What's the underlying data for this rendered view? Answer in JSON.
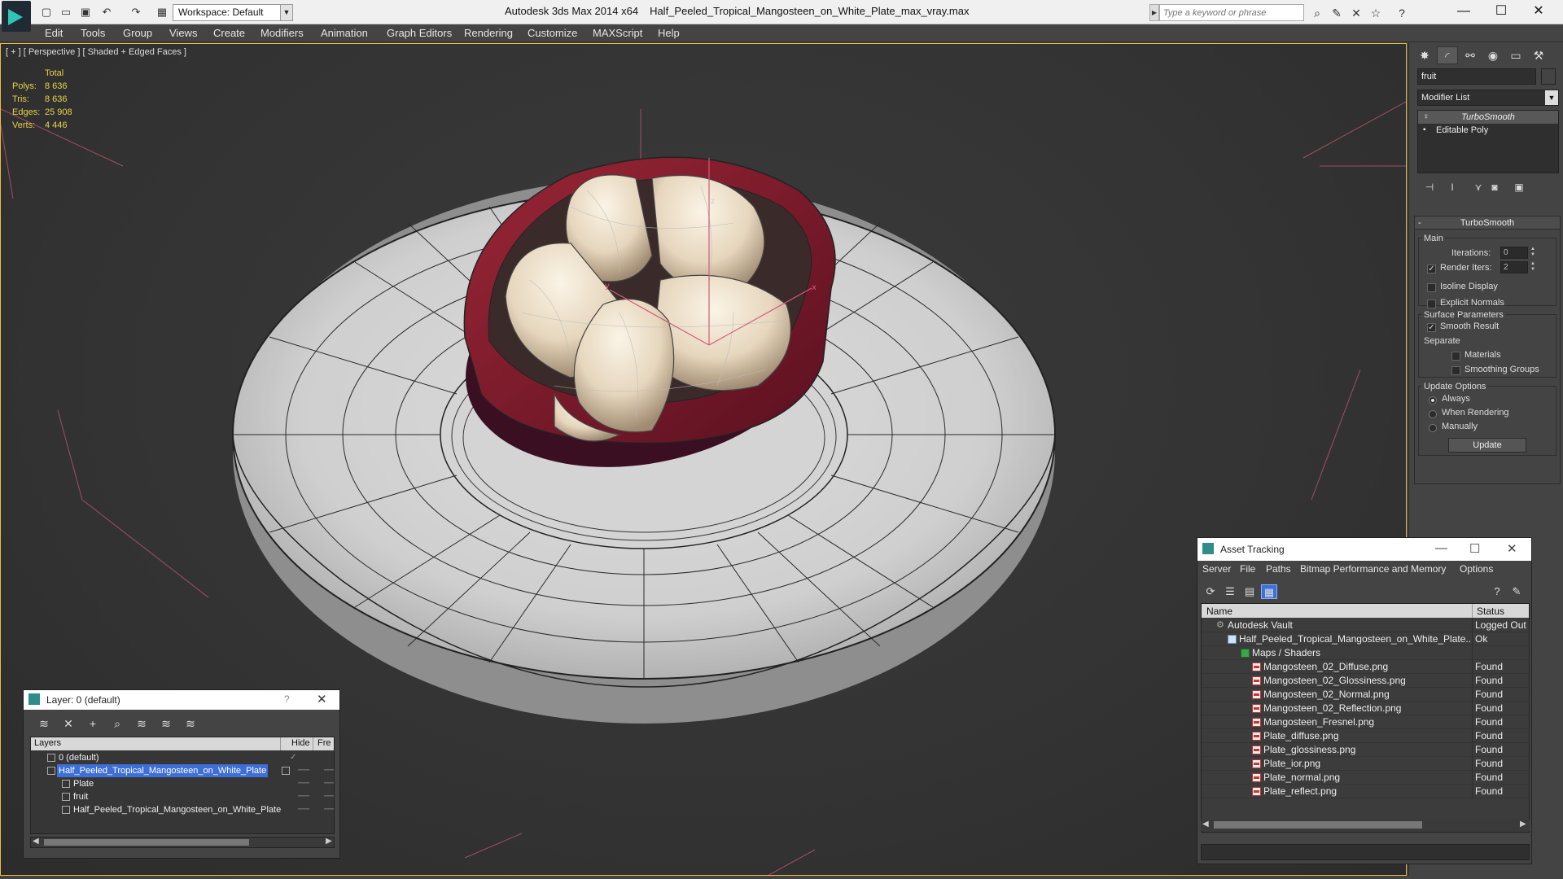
{
  "app": {
    "title": "Autodesk 3ds Max  2014 x64",
    "file": "Half_Peeled_Tropical_Mangosteen_on_White_Plate_max_vray.max",
    "workspace": "Workspace: Default",
    "search_placeholder": "Type a keyword or phrase"
  },
  "menu": [
    "Edit",
    "Tools",
    "Group",
    "Views",
    "Create",
    "Modifiers",
    "Animation",
    "Graph Editors",
    "Rendering",
    "Customize",
    "MAXScript",
    "Help"
  ],
  "viewport": {
    "label": "[ + ] [ Perspective ] [ Shaded + Edged Faces ]",
    "stats": {
      "total_label": "Total",
      "rows": [
        {
          "label": "Polys:",
          "value": "8 636"
        },
        {
          "label": "Tris:",
          "value": "8 636"
        },
        {
          "label": "Edges:",
          "value": "25 908"
        },
        {
          "label": "Verts:",
          "value": "4 446"
        }
      ]
    }
  },
  "command_panel": {
    "object_name": "fruit",
    "modifier_list": "Modifier List",
    "stack": [
      "TurboSmooth",
      "Editable Poly"
    ],
    "rollout_title": "TurboSmooth",
    "main_group": "Main",
    "iterations_label": "Iterations:",
    "iterations_value": "0",
    "render_iters_label": "Render Iters:",
    "render_iters_value": "2",
    "isoline_label": "Isoline Display",
    "explicit_normals_label": "Explicit Normals",
    "surface_group": "Surface Parameters",
    "smooth_result_label": "Smooth Result",
    "separate_label": "Separate",
    "materials_label": "Materials",
    "smoothing_groups_label": "Smoothing Groups",
    "update_group": "Update Options",
    "always_label": "Always",
    "when_rendering_label": "When Rendering",
    "manually_label": "Manually",
    "update_button": "Update"
  },
  "layer_dialog": {
    "title": "Layer: 0 (default)",
    "help": "?",
    "columns": {
      "layers": "Layers",
      "hide": "Hide",
      "freeze": "Fre"
    },
    "rows": [
      {
        "name": "0 (default)"
      },
      {
        "name": "Half_Peeled_Tropical_Mangosteen_on_White_Plate"
      },
      {
        "name": "Plate"
      },
      {
        "name": "fruit"
      },
      {
        "name": "Half_Peeled_Tropical_Mangosteen_on_White_Plate"
      }
    ]
  },
  "asset_tracking": {
    "title": "Asset Tracking",
    "menu": [
      "Server",
      "File",
      "Paths",
      "Bitmap Performance and Memory",
      "Options"
    ],
    "columns": {
      "name": "Name",
      "status": "Status"
    },
    "rows": [
      {
        "name": "Autodesk Vault",
        "status": "Logged Out"
      },
      {
        "name": "Half_Peeled_Tropical_Mangosteen_on_White_Plate...",
        "status": "Ok"
      },
      {
        "name": "Maps / Shaders",
        "status": ""
      },
      {
        "name": "Mangosteen_02_Diffuse.png",
        "status": "Found"
      },
      {
        "name": "Mangosteen_02_Glossiness.png",
        "status": "Found"
      },
      {
        "name": "Mangosteen_02_Normal.png",
        "status": "Found"
      },
      {
        "name": "Mangosteen_02_Reflection.png",
        "status": "Found"
      },
      {
        "name": "Mangosteen_Fresnel.png",
        "status": "Found"
      },
      {
        "name": "Plate_diffuse.png",
        "status": "Found"
      },
      {
        "name": "Plate_glossiness.png",
        "status": "Found"
      },
      {
        "name": "Plate_ior.png",
        "status": "Found"
      },
      {
        "name": "Plate_normal.png",
        "status": "Found"
      },
      {
        "name": "Plate_reflect.png",
        "status": "Found"
      }
    ]
  },
  "colors": {
    "viewport_border": "#eebb44",
    "stats_text": "#e8d24a",
    "selection": "#3d6fd6",
    "peel": "#8a1f2e",
    "flesh": "#efe3cf"
  }
}
